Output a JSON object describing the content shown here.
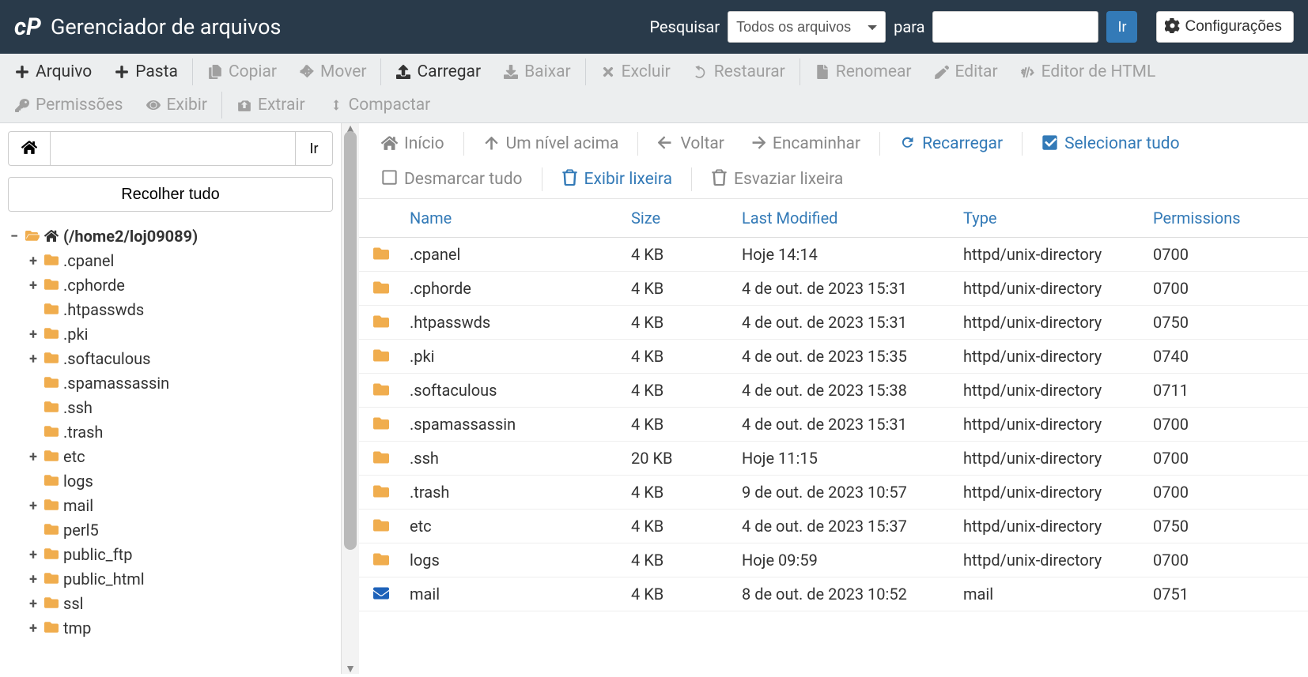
{
  "header": {
    "appTitle": "Gerenciador de arquivos",
    "searchLabel": "Pesquisar",
    "searchScope": "Todos os arquivos",
    "forLabel": "para",
    "goLabel": "Ir",
    "settingsLabel": "Configurações"
  },
  "toolbar": {
    "file": "Arquivo",
    "folder": "Pasta",
    "copy": "Copiar",
    "move": "Mover",
    "upload": "Carregar",
    "download": "Baixar",
    "delete": "Excluir",
    "restore": "Restaurar",
    "rename": "Renomear",
    "edit": "Editar",
    "htmlEditor": "Editor de HTML",
    "permissions": "Permissões",
    "view": "Exibir",
    "extract": "Extrair",
    "compress": "Compactar"
  },
  "sidebar": {
    "goLabel": "Ir",
    "collapseAll": "Recolher tudo",
    "root": "(/home2/loj09089)",
    "nodes": [
      {
        "label": ".cpanel",
        "expand": "+"
      },
      {
        "label": ".cphorde",
        "expand": "+"
      },
      {
        "label": ".htpasswds",
        "expand": ""
      },
      {
        "label": ".pki",
        "expand": "+"
      },
      {
        "label": ".softaculous",
        "expand": "+"
      },
      {
        "label": ".spamassassin",
        "expand": ""
      },
      {
        "label": ".ssh",
        "expand": ""
      },
      {
        "label": ".trash",
        "expand": ""
      },
      {
        "label": "etc",
        "expand": "+"
      },
      {
        "label": "logs",
        "expand": ""
      },
      {
        "label": "mail",
        "expand": "+"
      },
      {
        "label": "perl5",
        "expand": ""
      },
      {
        "label": "public_ftp",
        "expand": "+"
      },
      {
        "label": "public_html",
        "expand": "+"
      },
      {
        "label": "ssl",
        "expand": "+"
      },
      {
        "label": "tmp",
        "expand": "+"
      }
    ]
  },
  "filebar": {
    "home": "Início",
    "upOne": "Um nível acima",
    "back": "Voltar",
    "forward": "Encaminhar",
    "reload": "Recarregar",
    "selectAll": "Selecionar tudo",
    "deselectAll": "Desmarcar tudo",
    "viewTrash": "Exibir lixeira",
    "emptyTrash": "Esvaziar lixeira"
  },
  "table": {
    "headers": {
      "name": "Name",
      "size": "Size",
      "modified": "Last Modified",
      "type": "Type",
      "perm": "Permissions"
    },
    "rows": [
      {
        "icon": "folder",
        "name": ".cpanel",
        "size": "4 KB",
        "modified": "Hoje 14:14",
        "type": "httpd/unix-directory",
        "perm": "0700"
      },
      {
        "icon": "folder",
        "name": ".cphorde",
        "size": "4 KB",
        "modified": "4 de out. de 2023 15:31",
        "type": "httpd/unix-directory",
        "perm": "0700"
      },
      {
        "icon": "folder",
        "name": ".htpasswds",
        "size": "4 KB",
        "modified": "4 de out. de 2023 15:31",
        "type": "httpd/unix-directory",
        "perm": "0750"
      },
      {
        "icon": "folder",
        "name": ".pki",
        "size": "4 KB",
        "modified": "4 de out. de 2023 15:35",
        "type": "httpd/unix-directory",
        "perm": "0740"
      },
      {
        "icon": "folder",
        "name": ".softaculous",
        "size": "4 KB",
        "modified": "4 de out. de 2023 15:38",
        "type": "httpd/unix-directory",
        "perm": "0711"
      },
      {
        "icon": "folder",
        "name": ".spamassassin",
        "size": "4 KB",
        "modified": "4 de out. de 2023 15:31",
        "type": "httpd/unix-directory",
        "perm": "0700"
      },
      {
        "icon": "folder",
        "name": ".ssh",
        "size": "20 KB",
        "modified": "Hoje 11:15",
        "type": "httpd/unix-directory",
        "perm": "0700"
      },
      {
        "icon": "folder",
        "name": ".trash",
        "size": "4 KB",
        "modified": "9 de out. de 2023 10:57",
        "type": "httpd/unix-directory",
        "perm": "0700"
      },
      {
        "icon": "folder",
        "name": "etc",
        "size": "4 KB",
        "modified": "4 de out. de 2023 15:37",
        "type": "httpd/unix-directory",
        "perm": "0750"
      },
      {
        "icon": "folder",
        "name": "logs",
        "size": "4 KB",
        "modified": "Hoje 09:59",
        "type": "httpd/unix-directory",
        "perm": "0700"
      },
      {
        "icon": "mail",
        "name": "mail",
        "size": "4 KB",
        "modified": "8 de out. de 2023 10:52",
        "type": "mail",
        "perm": "0751"
      }
    ]
  }
}
